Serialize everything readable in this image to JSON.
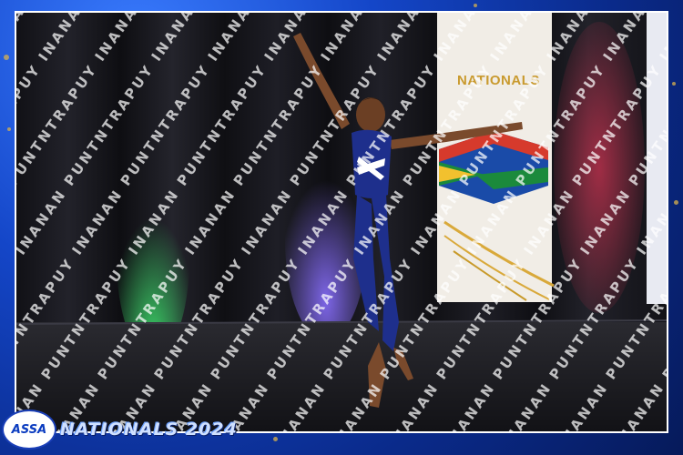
{
  "banner": {
    "text": "NATIONALS"
  },
  "branding": {
    "logo_text": "ASSA",
    "event": "NATIONALS 2024"
  },
  "watermark": {
    "text": "INANAN PUNTNTRAPUY"
  },
  "colors": {
    "frame": "#1446c8",
    "accent_gold": "#d9b24c",
    "costume": "#1e2f8c",
    "curtain": "#141418"
  }
}
